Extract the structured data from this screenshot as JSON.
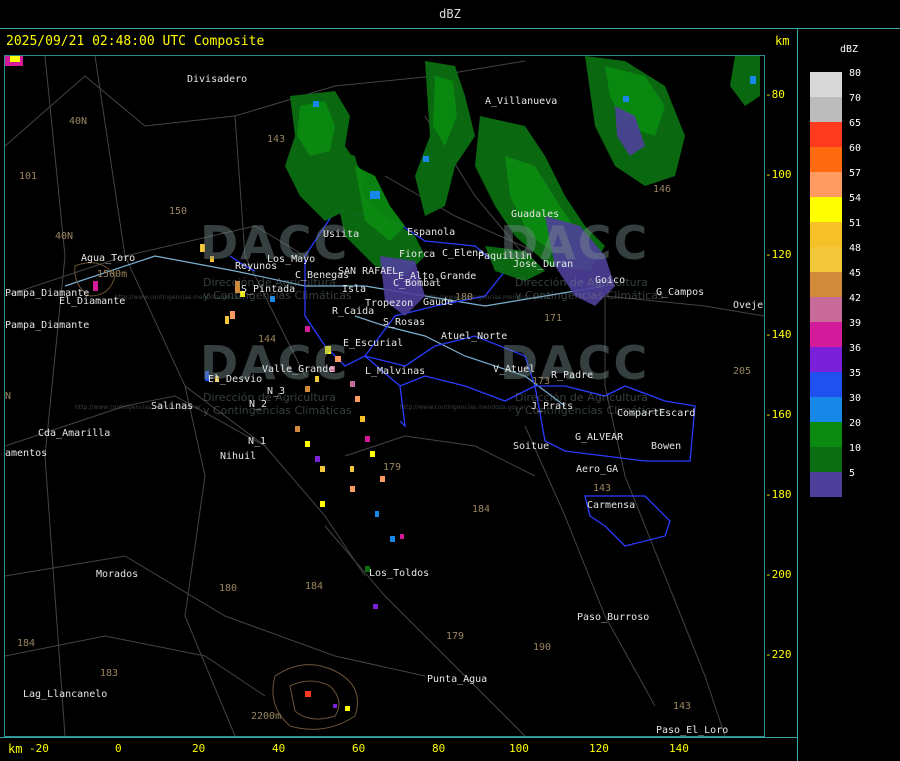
{
  "header": {
    "product_title": "dBZ",
    "timestamp_line": "2025/09/21 02:48:00 UTC Composite",
    "km_label_top": "km",
    "km_label_bottom": "km"
  },
  "legend": {
    "title": "dBZ",
    "entries": [
      {
        "label": "80",
        "color": "#d8d8d8"
      },
      {
        "label": "70",
        "color": "#bcbcbc"
      },
      {
        "label": "65",
        "color": "#ff3a1e"
      },
      {
        "label": "60",
        "color": "#ff6a10"
      },
      {
        "label": "57",
        "color": "#ff9a60"
      },
      {
        "label": "54",
        "color": "#ffff00"
      },
      {
        "label": "51",
        "color": "#f6c028"
      },
      {
        "label": "48",
        "color": "#f2c83a"
      },
      {
        "label": "45",
        "color": "#d08a3a"
      },
      {
        "label": "42",
        "color": "#c86a9a"
      },
      {
        "label": "39",
        "color": "#d21a9a"
      },
      {
        "label": "36",
        "color": "#7a20d8"
      },
      {
        "label": "35",
        "color": "#2050f0"
      },
      {
        "label": "30",
        "color": "#1888e8"
      },
      {
        "label": "20",
        "color": "#0a8a10"
      },
      {
        "label": "10",
        "color": "#0b6e12"
      },
      {
        "label": "5",
        "color": "#4e3f9a"
      }
    ]
  },
  "axes": {
    "y_ticks": [
      "-80",
      "-100",
      "-120",
      "-140",
      "-160",
      "-180",
      "-200",
      "-220"
    ],
    "x_ticks": [
      "-20",
      "0",
      "20",
      "40",
      "60",
      "80",
      "100",
      "120",
      "140"
    ]
  },
  "places": [
    "Divisadero",
    "A_Villanueva",
    "Usiita",
    "Espanola",
    "Fiorca",
    "C_Elena",
    "Paquillin",
    "Jose_Duran",
    "Guadales",
    "C_Benegas",
    "SAN RAFAEL",
    "E_Alto_Grande",
    "Goico",
    "G_Campos",
    "Oveje",
    "Agua_Toro",
    "Pampa_Diamante",
    "El_Diamante",
    "Pampa_Diamante",
    "Los_Mayo",
    "Reyunos",
    "S_Pintada",
    "C_Bombal",
    "Isla",
    "Tropezon",
    "R_Caida",
    "Gaude",
    "S_Rosas",
    "Atuel_Norte",
    "E_Escurial",
    "Valle_Grande",
    "L_Malvinas",
    "V_Atuel",
    "R_Padre",
    "El_Desvio",
    "N_3",
    "Salinas",
    "N_2",
    "J_Prats",
    "CompartEscard",
    "Cda_Amarilla",
    "N_1",
    "Nihuil",
    "amentos",
    "Soitue",
    "G_ALVEAR",
    "Bowen",
    "Aero_GA",
    "Carmensa",
    "Morados",
    "Los_Toldos",
    "Paso_Burroso",
    "Punta_Agua",
    "Lag_Llancanelo",
    "Paso_El_Loro"
  ],
  "routes": [
    "40N",
    "101",
    "40N",
    "143",
    "150",
    "146",
    "171",
    "180",
    "144",
    "173",
    "143",
    "179",
    "184",
    "180",
    "184",
    "179",
    "190",
    "184",
    "183",
    "143",
    "205",
    "1500m",
    "2200m",
    "N"
  ],
  "watermark": {
    "brand": "DACC",
    "line1": "Dirección de Agricultura",
    "line2": "y Contingencias Climáticas",
    "url": "http://www.contingencias.mendoza.gov.ar"
  }
}
